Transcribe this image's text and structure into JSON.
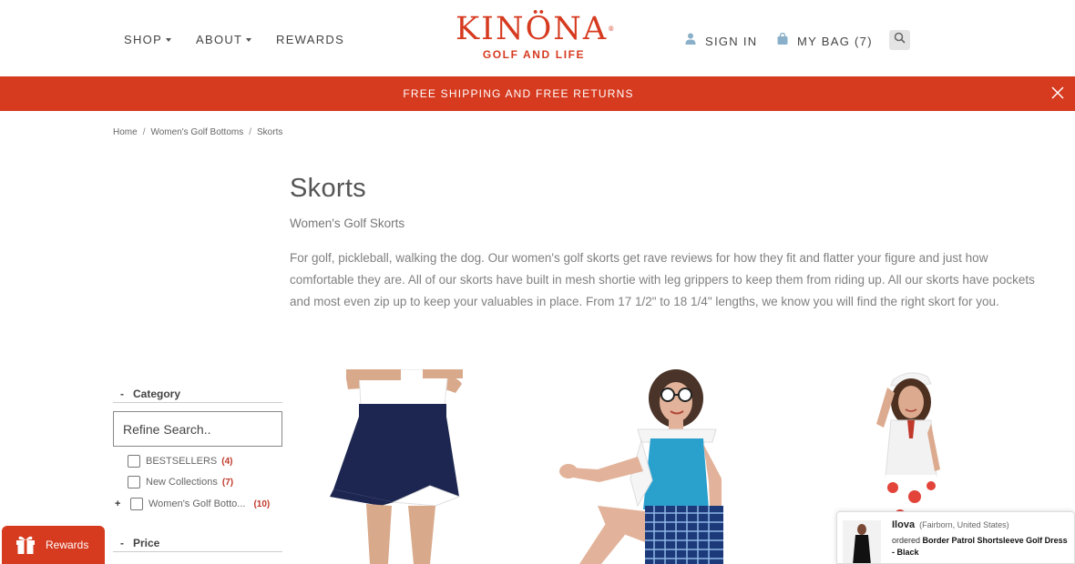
{
  "header": {
    "nav": [
      {
        "label": "SHOP",
        "has_dropdown": true
      },
      {
        "label": "ABOUT",
        "has_dropdown": true
      },
      {
        "label": "REWARDS",
        "has_dropdown": false
      }
    ],
    "logo": {
      "main": "KINÖNA",
      "tagline": "GOLF AND LIFE",
      "registered": "®"
    },
    "sign_in": {
      "label": "SIGN IN",
      "icon": "user-icon"
    },
    "bag": {
      "label": "MY BAG (7)",
      "icon": "bag-icon"
    },
    "search": {
      "icon": "search-icon"
    },
    "colors": {
      "brand": "#d63a1f"
    }
  },
  "promo": {
    "text": "FREE SHIPPING AND FREE RETURNS",
    "close_icon": "close-icon"
  },
  "breadcrumb": [
    "Home",
    "Women's Golf Bottoms",
    "Skorts"
  ],
  "page": {
    "title": "Skorts",
    "subtitle": "Women's Golf Skorts",
    "description": "For golf, pickleball, walking the dog.  Our women's golf skorts get rave reviews for how they fit and flatter your figure and just how comfortable they are.  All of our skorts have built in mesh shortie with leg grippers to keep them from riding up.  All our skorts have pockets and most even zip up to keep your valuables in place.  From 17 1/2\" to 18 1/4\" lengths, we know you will find the right skort for you."
  },
  "filters": {
    "category": {
      "label": "Category",
      "search_placeholder": "Refine Search..",
      "options": [
        {
          "label": "BESTSELLERS",
          "count": "(4)"
        },
        {
          "label": "New Collections",
          "count": "(7)"
        },
        {
          "label": "Women's Golf Botto...",
          "count": "(10)",
          "expandable": true
        }
      ]
    },
    "price": {
      "label": "Price"
    }
  },
  "rewards_button": {
    "label": "Rewards",
    "icon": "gift-icon"
  },
  "popup": {
    "name": "Ilova",
    "location": "(Fairborn, United States)",
    "action": "ordered",
    "product": "Border Patrol Shortsleeve Golf Dress - Black"
  }
}
